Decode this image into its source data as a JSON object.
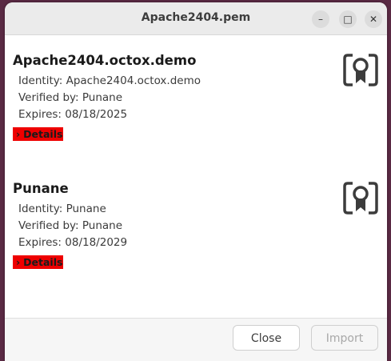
{
  "window": {
    "title": "Apache2404.pem",
    "controls": [
      "minimize-icon",
      "maximize-icon",
      "close-icon"
    ]
  },
  "certificates": [
    {
      "name": "Apache2404.octox.demo",
      "identity": "Identity: Apache2404.octox.demo",
      "verified_by": "Verified by: Punane",
      "expires": "Expires: 08/18/2025",
      "details_label": "Details",
      "icon": "certificate-icon"
    },
    {
      "name": "Punane",
      "identity": "Identity: Punane",
      "verified_by": "Verified by: Punane",
      "expires": "Expires: 08/18/2029",
      "details_label": "Details",
      "icon": "certificate-icon"
    }
  ],
  "footer": {
    "close_label": "Close",
    "import_label": "Import"
  },
  "colors": {
    "details_highlight": "#ee0000",
    "desktop_background": "#5a2a44"
  }
}
